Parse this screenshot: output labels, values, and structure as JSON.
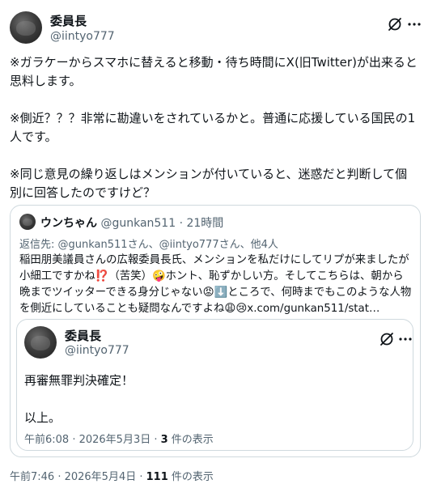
{
  "post": {
    "author_name": "委員長",
    "author_handle": "@iintyo777",
    "paragraphs": [
      "※ガラケーからスマホに替えると移動・待ち時間にX(旧Twitter)が出来ると思料します。",
      "※側近？？？非常に勘違いをされているかと。普通に応援している国民の1人です。",
      "※同じ意見の繰り返しはメンションが付いていると、迷惑だと判断して個別に回答したのですけど？"
    ],
    "timestamp": "午前7:46 · 2026年5月4日 · ",
    "views_count": "111",
    "views_label": " 件の表示"
  },
  "quote": {
    "author_name": "ウンちゃん",
    "author_handle": "@gunkan511",
    "age": " · 21時間",
    "reply_prefix": "返信先: ",
    "reply_to": "@gunkan511さん、@iintyo777さん、他4人",
    "text_1": "稲田朋美議員さんの広報委員長氏、メンションを私だけにしてリプが来ましたが小細工ですかね",
    "emoji_1": "⁉️",
    "text_2": "（苦笑）",
    "emoji_2": "🤪",
    "text_3": "ホント、恥ずかしい方。そしてこちらは、朝から晩までツイッターできる身分じゃない",
    "emoji_3": "😡⬇️",
    "text_4": "ところで、何時までもこのような人物を側近にしていることも疑問なんですよね",
    "emoji_4": "😩😢",
    "link": "x.com/gunkan511/stat…"
  },
  "inner": {
    "author_name": "委員長",
    "author_handle": "@iintyo777",
    "line_1": "再審無罪判決確定！",
    "line_2": "以上。",
    "timestamp": "午前6:08 · 2026年5月3日 · ",
    "views_count": "3",
    "views_label": " 件の表示"
  },
  "icons": {
    "grok": "grok-icon",
    "more": "more-icon"
  }
}
